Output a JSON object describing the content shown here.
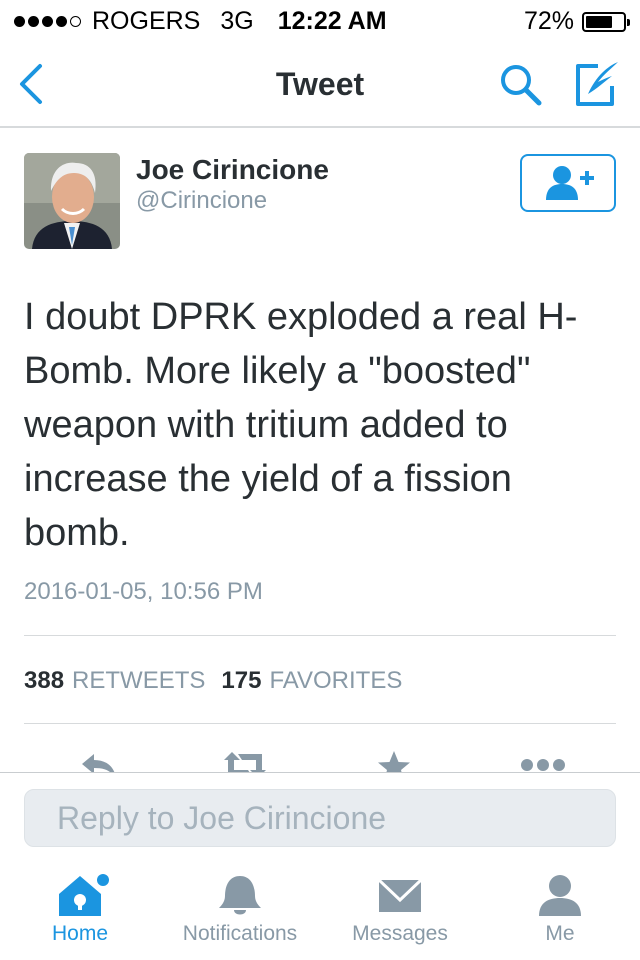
{
  "status_bar": {
    "carrier": "ROGERS",
    "network": "3G",
    "time": "12:22 AM",
    "battery_percent": "72%",
    "battery_level": 0.72,
    "signal_bars": 4
  },
  "nav": {
    "title": "Tweet",
    "back_icon": "chevron-left-icon",
    "search_icon": "search-icon",
    "compose_icon": "compose-icon",
    "accent_color": "#1b95e0"
  },
  "tweet": {
    "author_name": "Joe Cirincione",
    "author_handle": "@Cirincione",
    "text": "I doubt DPRK exploded a real H-Bomb. More likely a \"boosted\" weapon with tritium added to increase the yield of a fission bomb.",
    "timestamp": "2016-01-05, 10:56 PM",
    "retweets_count": "388",
    "retweets_label": "RETWEETS",
    "favorites_count": "175",
    "favorites_label": "FAVORITES"
  },
  "actions": [
    "reply-icon",
    "retweet-icon",
    "favorite-star-icon",
    "more-icon"
  ],
  "reply": {
    "placeholder": "Reply to Joe Cirincione"
  },
  "tabbar": {
    "items": [
      {
        "label": "Home",
        "icon": "home-icon",
        "active": true
      },
      {
        "label": "Notifications",
        "icon": "bell-icon",
        "active": false
      },
      {
        "label": "Messages",
        "icon": "envelope-icon",
        "active": false
      },
      {
        "label": "Me",
        "icon": "person-icon",
        "active": false
      }
    ]
  },
  "colors": {
    "accent": "#1b95e0",
    "text": "#292f33",
    "muted": "#8899a6",
    "icon_gray": "#8899a6"
  }
}
